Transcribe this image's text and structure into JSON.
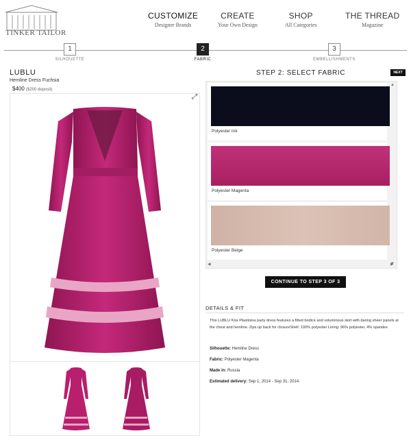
{
  "logo": {
    "text": "TINKER TAILOR"
  },
  "nav": [
    {
      "label": "CUSTOMIZE",
      "sub": "Designer Brands"
    },
    {
      "label": "CREATE",
      "sub": "Your Own Design"
    },
    {
      "label": "SHOP",
      "sub": "All Categories"
    },
    {
      "label": "THE THREAD",
      "sub": "Magazine"
    }
  ],
  "steps": [
    {
      "num": "1",
      "label": "SILHOUETTE"
    },
    {
      "num": "2",
      "label": "FABRIC"
    },
    {
      "num": "3",
      "label": "EMBELLISHMENTS"
    }
  ],
  "product": {
    "brand": "LUBLU",
    "name": "Hemline Dress Fuchsia",
    "price": "$400",
    "deposit": "($200 deposit)"
  },
  "fabric": {
    "title": "STEP 2: SELECT FABRIC",
    "next_label": "NEXT",
    "options": [
      {
        "name": "Polyester Ink",
        "color": "#0b0d1c"
      },
      {
        "name": "Polyester Magenta",
        "color": "#b5296f"
      },
      {
        "name": "Polyester Beige",
        "color": "#d6b8ab"
      }
    ],
    "continue_label": "CONTINUE TO STEP 3 OF 3"
  },
  "details": {
    "title": "DETAILS & FIT",
    "description": "This LUBLU Kira Plastinina party dress features a fitted bodice and voluminous skirt with daring sheer panels at the chest and hemline. Zips up back for closureShell: 100% polyester Lining: 96% polyester, 4% spandex",
    "silhouette_label": "Silhouette:",
    "silhouette_value": "Hemline Dress",
    "fabric_label": "Fabric:",
    "fabric_value": "Polyester Magenta",
    "made_label": "Made in:",
    "made_value": "Russia",
    "delivery_label": "Estimated delivery:",
    "delivery_value": "Sep 1, 2014 - Sep 31, 2014."
  },
  "colors": {
    "dress": "#b8206e",
    "accent": "#111111"
  },
  "icons": {
    "expand": "expand-icon",
    "logo": "building-logo-icon",
    "scroll_up": "triangle-up-icon",
    "scroll_down": "triangle-down-icon"
  }
}
